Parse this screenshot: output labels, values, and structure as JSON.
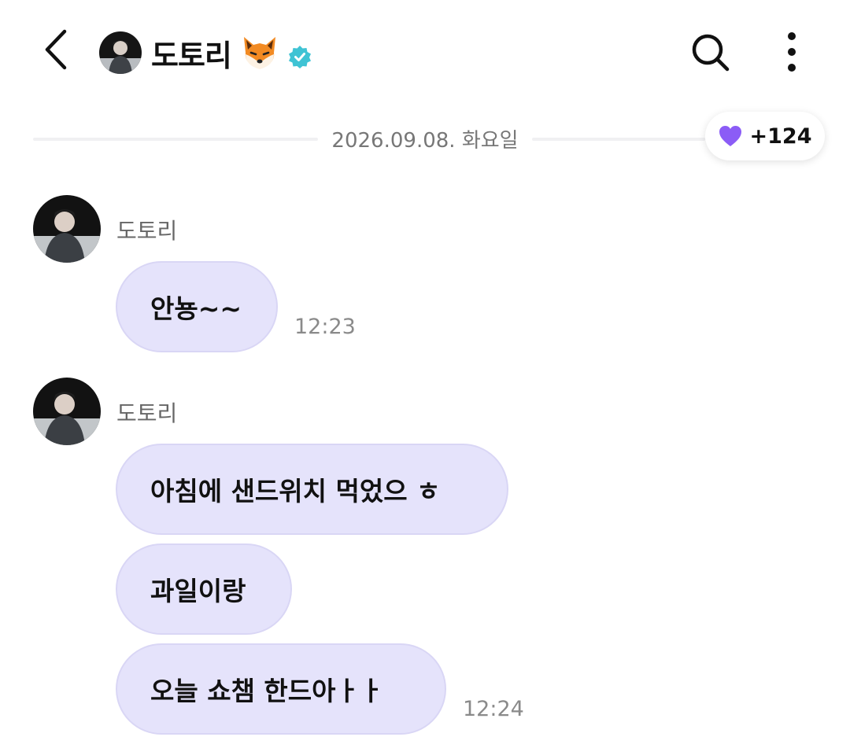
{
  "header": {
    "title": "도토리",
    "title_emoji": "fox-face",
    "verified": true
  },
  "date_divider": {
    "text": "2026.09.08. 화요일"
  },
  "reaction": {
    "count": "+124",
    "icon": "purple-heart",
    "color": "#8b5cf6"
  },
  "colors": {
    "bubble": "#e5e3fb",
    "verified_badge": "#3fc3d4"
  },
  "messages": [
    {
      "sender": "도토리",
      "bubbles": [
        {
          "text": "안뇽~~",
          "time": "12:23"
        }
      ]
    },
    {
      "sender": "도토리",
      "bubbles": [
        {
          "text": "아침에 샌드위치 먹었으 ㅎ",
          "time": ""
        },
        {
          "text": "과일이랑",
          "time": ""
        },
        {
          "text": "오늘 쇼챔 한드아ㅏㅏ",
          "time": "12:24"
        }
      ]
    }
  ]
}
